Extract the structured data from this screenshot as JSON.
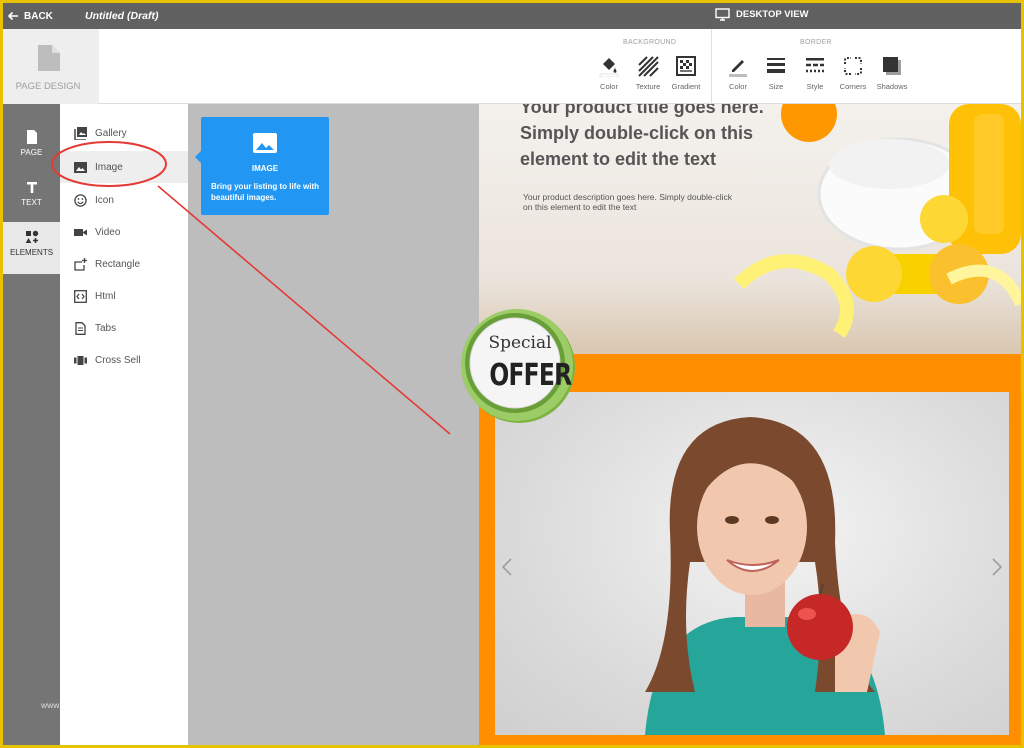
{
  "topbar": {
    "back_label": "BACK",
    "title": "Untitled (Draft)",
    "view_label": "DESKTOP VIEW"
  },
  "toolbar": {
    "page_design_label": "PAGE DESIGN",
    "background_group": "BACKGROUND",
    "border_group": "BORDER",
    "background_tools": [
      "Color",
      "Texture",
      "Gradient"
    ],
    "border_tools": [
      "Color",
      "Size",
      "Style",
      "Corners",
      "Shadows"
    ]
  },
  "rail": {
    "items": [
      {
        "label": "PAGE",
        "icon": "page-icon"
      },
      {
        "label": "TEXT",
        "icon": "text-icon"
      },
      {
        "label": "ELEMENTS",
        "icon": "shapes-icon"
      }
    ]
  },
  "panel": {
    "items": [
      {
        "label": "Gallery",
        "icon": "gallery-icon"
      },
      {
        "label": "Image",
        "icon": "image-icon"
      },
      {
        "label": "Icon",
        "icon": "smiley-icon"
      },
      {
        "label": "Video",
        "icon": "video-camera-icon"
      },
      {
        "label": "Rectangle",
        "icon": "rectangle-add-icon"
      },
      {
        "label": "Html",
        "icon": "code-icon"
      },
      {
        "label": "Tabs",
        "icon": "tabs-icon"
      },
      {
        "label": "Cross Sell",
        "icon": "cross-sell-icon"
      }
    ],
    "active": "Image"
  },
  "tooltip": {
    "title": "IMAGE",
    "description": "Bring your listing to life with beautiful images."
  },
  "canvas": {
    "hero_heading": "Your product title goes here. Simply double-click on this element to edit the text",
    "hero_description": "Your product description goes here. Simply double-click on this element to edit the text",
    "badge_line1": "Special",
    "badge_line2": "OFFER"
  },
  "colors": {
    "frame": "#e6c200",
    "topbar": "#616161",
    "rail": "#757575",
    "accent_blue": "#2196f3",
    "promo_orange": "#ff8f00",
    "annotation_red": "#e53935",
    "badge_green": "#8bc34a"
  },
  "watermark": "www.heritagechristiancollege.com"
}
